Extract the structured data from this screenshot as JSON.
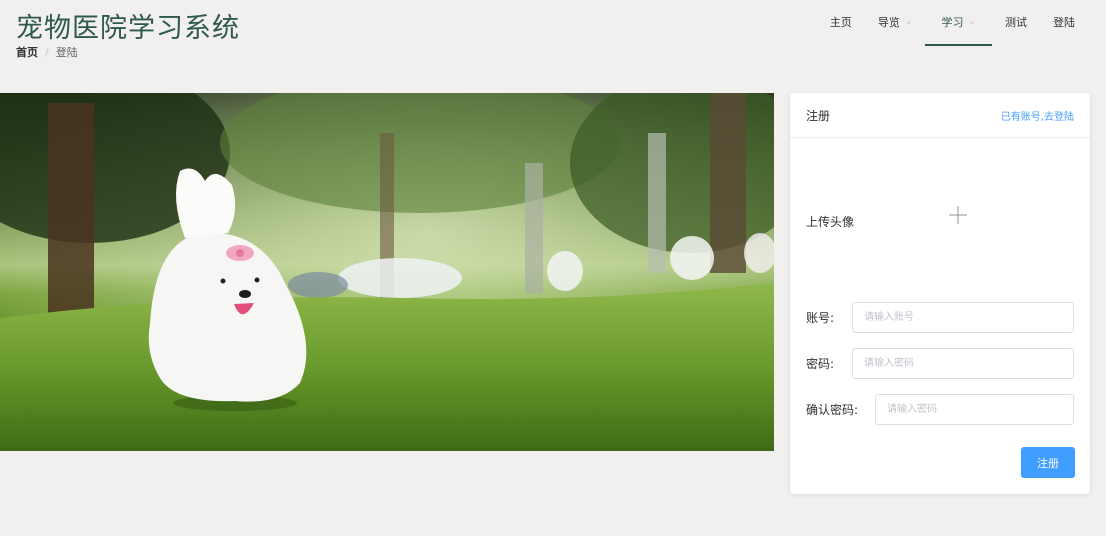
{
  "app": {
    "title": "宠物医院学习系统"
  },
  "breadcrumb": {
    "home": "首页",
    "separator": "/",
    "current": "登陆"
  },
  "nav": {
    "items": [
      {
        "label": "主页",
        "has_dropdown": false,
        "active": false
      },
      {
        "label": "导览",
        "has_dropdown": true,
        "active": false
      },
      {
        "label": "学习",
        "has_dropdown": true,
        "active": true
      },
      {
        "label": "测试",
        "has_dropdown": false,
        "active": false
      },
      {
        "label": "登陆",
        "has_dropdown": false,
        "active": false
      }
    ]
  },
  "hero": {
    "image": "white-dog-running-on-grass"
  },
  "register": {
    "title": "注册",
    "login_link": "已有账号,去登陆",
    "avatar_label": "上传头像",
    "avatar_icon": "plus-icon",
    "account": {
      "label": "账号:",
      "placeholder": "请输入账号",
      "value": ""
    },
    "password": {
      "label": "密码:",
      "placeholder": "请输入密码",
      "value": ""
    },
    "confirm": {
      "label": "确认密码:",
      "placeholder": "请输入密码",
      "value": ""
    },
    "submit_label": "注册"
  },
  "colors": {
    "brand": "#2f5a4a",
    "primary": "#409eff",
    "background": "#f1f0ef"
  }
}
